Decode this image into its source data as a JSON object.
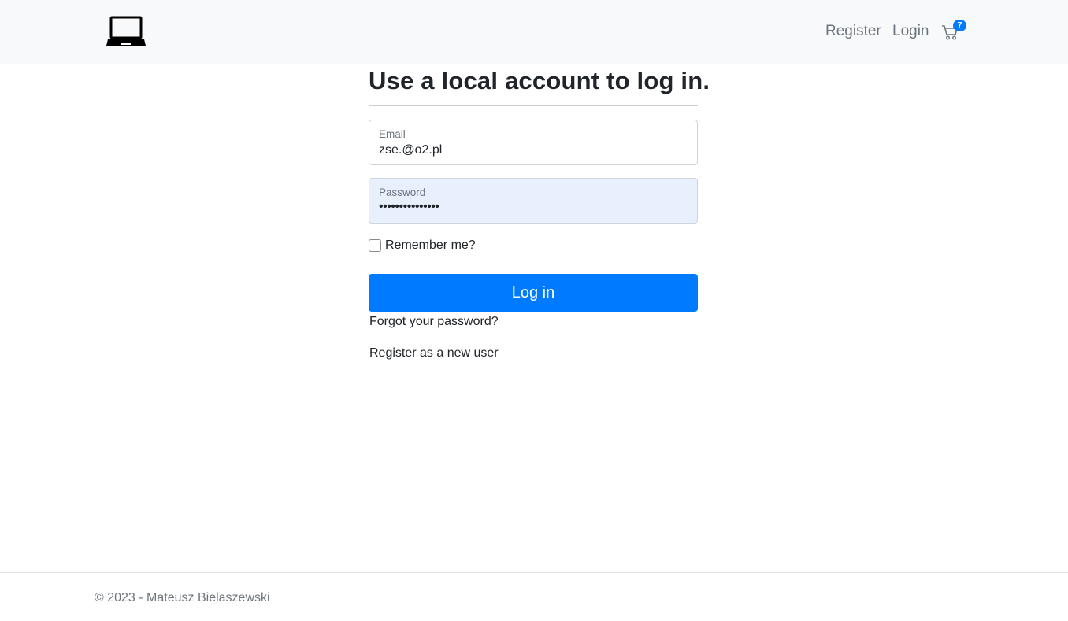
{
  "navbar": {
    "logo_icon": "laptop-icon",
    "links": {
      "register": "Register",
      "login": "Login"
    },
    "cart": {
      "icon": "cart-icon",
      "count": "7"
    }
  },
  "login": {
    "title": "Use a local account to log in.",
    "email": {
      "label": "Email",
      "value": "zse.@o2.pl"
    },
    "password": {
      "label": "Password",
      "masked_value": "•••••••••••••••"
    },
    "remember_label": "Remember me?",
    "submit_label": "Log in",
    "forgot_link": "Forgot your password?",
    "register_link": "Register as a new user"
  },
  "footer": {
    "text": "© 2023 - Mateusz Bielaszewski"
  },
  "colors": {
    "primary": "#007bff",
    "navbar_bg": "#f8f9fa",
    "autofill_bg": "#e8f0fe",
    "muted_text": "#6c757d"
  }
}
